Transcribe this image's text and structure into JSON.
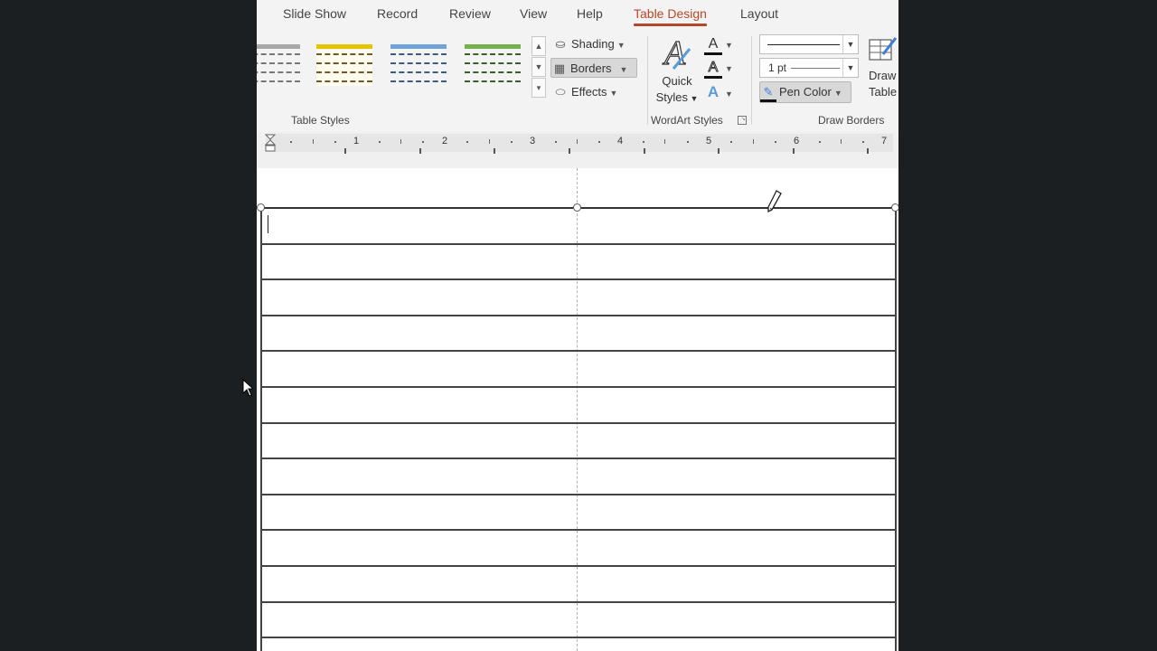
{
  "ribbon": {
    "tabs": [
      {
        "label": "Slide Show",
        "active": false
      },
      {
        "label": "Record",
        "active": false
      },
      {
        "label": "Review",
        "active": false
      },
      {
        "label": "View",
        "active": false
      },
      {
        "label": "Help",
        "active": false
      },
      {
        "label": "Table Design",
        "active": true
      },
      {
        "label": "Layout",
        "active": false
      }
    ],
    "accent_color": "#b7472a",
    "table_styles": {
      "label": "Table Styles",
      "thumbnails": [
        {
          "name": "gray-style",
          "color": "#9a9a9a"
        },
        {
          "name": "gold-style",
          "color": "#e6b800"
        },
        {
          "name": "blue-style",
          "color": "#5b9bd5"
        },
        {
          "name": "green-style",
          "color": "#70ad47"
        }
      ],
      "shading_label": "Shading",
      "borders_label": "Borders",
      "effects_label": "Effects"
    },
    "wordart": {
      "label": "WordArt Styles",
      "quick_styles_line1": "Quick",
      "quick_styles_line2": "Styles",
      "text_fill_icon": "A",
      "text_outline_icon": "A",
      "text_effects_icon": "A"
    },
    "draw_borders": {
      "label": "Draw Borders",
      "pen_weight": "1 pt",
      "pen_color_label": "Pen Color",
      "draw_table_line1": "Draw",
      "draw_table_line2": "Table"
    }
  },
  "ruler": {
    "numbers": [
      "1",
      "2",
      "3",
      "4",
      "5",
      "6",
      "7"
    ]
  },
  "document": {
    "table_rows": 12,
    "table_columns": 2
  }
}
